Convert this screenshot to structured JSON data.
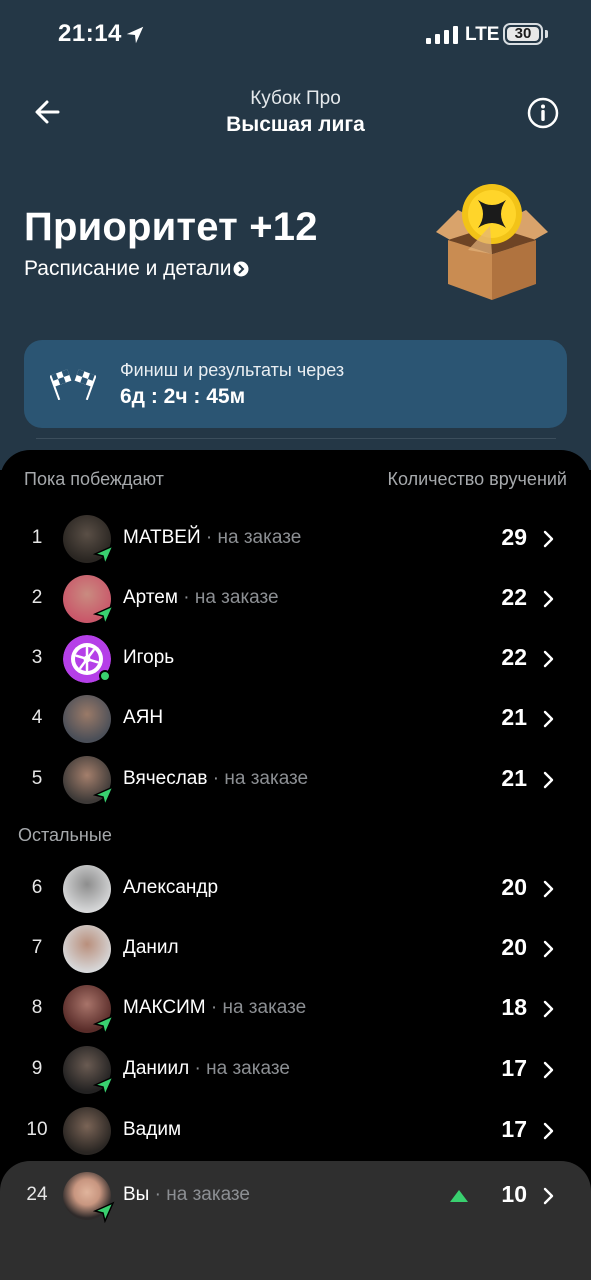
{
  "status_bar": {
    "time": "21:14",
    "network": "LTE",
    "battery": "30"
  },
  "header": {
    "subtitle": "Кубок Про",
    "title": "Высшая лига"
  },
  "hero": {
    "title": "Приоритет +12",
    "link": "Расписание и детали"
  },
  "timer": {
    "label": "Финиш и результаты через",
    "value": "6д : 2ч : 45м"
  },
  "leaders": {
    "heading_left": "Пока побеждают",
    "heading_right": "Количество вручений",
    "rows": [
      {
        "rank": "1",
        "name": "МАТВЕЙ",
        "status": " · на заказе",
        "score": "29"
      },
      {
        "rank": "2",
        "name": "Артем",
        "status": " · на заказе",
        "score": "22"
      },
      {
        "rank": "3",
        "name": "Игорь",
        "status": "",
        "score": "22"
      },
      {
        "rank": "4",
        "name": "АЯН",
        "status": "",
        "score": "21"
      },
      {
        "rank": "5",
        "name": "Вячеслав",
        "status": " · на заказе",
        "score": "21"
      }
    ]
  },
  "others": {
    "heading": "Остальные",
    "rows": [
      {
        "rank": "6",
        "name": "Александр",
        "status": "",
        "score": "20"
      },
      {
        "rank": "7",
        "name": "Данил",
        "status": "",
        "score": "20"
      },
      {
        "rank": "8",
        "name": "МАКСИМ",
        "status": " · на заказе",
        "score": "18"
      },
      {
        "rank": "9",
        "name": "Даниил",
        "status": " · на заказе",
        "score": "17"
      },
      {
        "rank": "10",
        "name": "Вадим",
        "status": "",
        "score": "17"
      }
    ]
  },
  "me": {
    "rank": "24",
    "name": "Вы",
    "status": " · на заказе",
    "score": "10"
  },
  "colors": {
    "accent_green": "#39d06f",
    "header_bg": "#243746",
    "card_bg": "#2b5573",
    "me_bar_bg": "#2f2f2f"
  },
  "icons": [
    "location-arrow-icon",
    "signal-icon",
    "back-arrow-icon",
    "info-icon",
    "chevron-circle-icon",
    "box-coin-icon",
    "checkered-flags-icon",
    "navigation-badge-icon",
    "wheel-icon",
    "chevron-right-icon",
    "rank-up-icon"
  ]
}
